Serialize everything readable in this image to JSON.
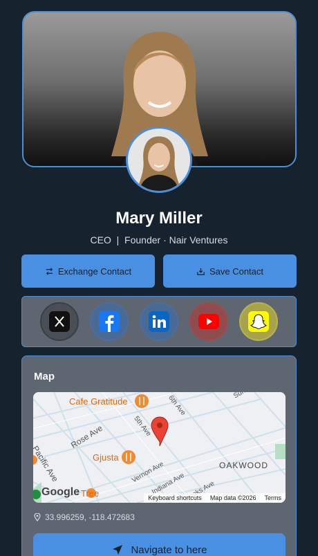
{
  "profile": {
    "name": "Mary Miller",
    "subtitle": "CEO  |  Founder · Nair Ventures"
  },
  "actions": {
    "exchange_label": "Exchange Contact",
    "save_label": "Save Contact"
  },
  "social": [
    {
      "icon": "x-icon",
      "color": "#111111"
    },
    {
      "icon": "facebook-icon",
      "color": "#1877f2"
    },
    {
      "icon": "linkedin-icon",
      "color": "#0a66c2"
    },
    {
      "icon": "youtube-icon",
      "color": "#ff0000"
    },
    {
      "icon": "snapchat-icon",
      "color": "#fffc00"
    }
  ],
  "map": {
    "title": "Map",
    "places": [
      "Cafe Gratitude",
      "Gjusta",
      "Tree"
    ],
    "streets": [
      "Pacific Ave",
      "Rose Ave",
      "5th Ave",
      "6th Ave",
      "Vernon Ave",
      "Indiana Ave",
      "Brooks Ave",
      "Sunset Ave"
    ],
    "neighborhood": "OAKWOOD",
    "attribution_brand": "Google",
    "keyboard_shortcuts": "Keyboard shortcuts",
    "map_data": "Map data ©2026",
    "terms": "Terms"
  },
  "location": {
    "coords": "33.996259, -118.472683",
    "navigate_label": "Navigate to here"
  },
  "colors": {
    "background": "#17222f",
    "accent": "#4a90e2",
    "card": "#5e6671"
  }
}
